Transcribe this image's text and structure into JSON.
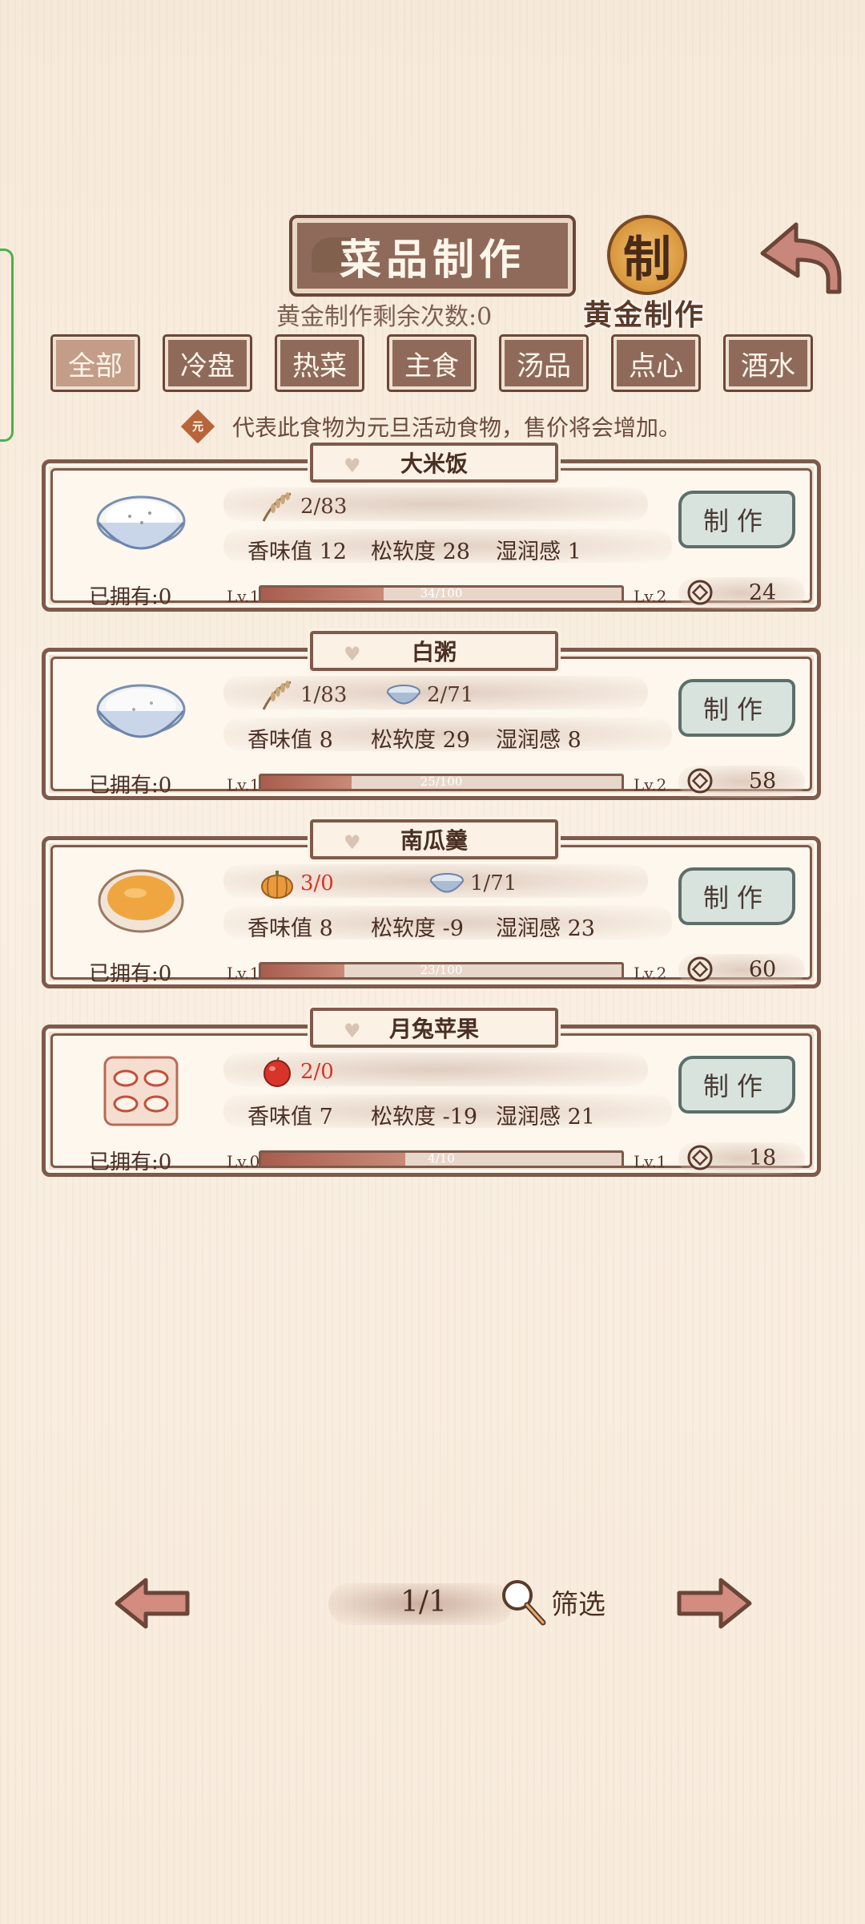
{
  "header": {
    "title": "菜品制作",
    "remaining_gold": "黄金制作剩余次数:0",
    "gold_seal_char": "制",
    "gold_label": "黄金制作"
  },
  "tabs": [
    {
      "label": "全部",
      "active": true
    },
    {
      "label": "冷盘",
      "active": false
    },
    {
      "label": "热菜",
      "active": false
    },
    {
      "label": "主食",
      "active": false
    },
    {
      "label": "汤品",
      "active": false
    },
    {
      "label": "点心",
      "active": false
    },
    {
      "label": "酒水",
      "active": false
    }
  ],
  "notice": {
    "badge": "元",
    "text": "代表此食物为元旦活动食物，售价将会增加。"
  },
  "dishes": [
    {
      "name": "大米饭",
      "owned": "已拥有:0",
      "ingredients": [
        {
          "icon": "rice-stalk-icon",
          "count": "2/83",
          "short": false
        }
      ],
      "stats": {
        "aroma": "香味值 12",
        "softness": "松软度 28",
        "moisture": "湿润感 1"
      },
      "level_current": "Lv.1",
      "level_next": "Lv.2",
      "progress_text": "34/100",
      "progress": 0.34,
      "make_label": "制作",
      "price": "24"
    },
    {
      "name": "白粥",
      "owned": "已拥有:0",
      "ingredients": [
        {
          "icon": "rice-stalk-icon",
          "count": "1/83",
          "short": false
        },
        {
          "icon": "water-bowl-icon",
          "count": "2/71",
          "short": false
        }
      ],
      "stats": {
        "aroma": "香味值 8",
        "softness": "松软度 29",
        "moisture": "湿润感 8"
      },
      "level_current": "Lv.1",
      "level_next": "Lv.2",
      "progress_text": "25/100",
      "progress": 0.25,
      "make_label": "制作",
      "price": "58"
    },
    {
      "name": "南瓜羹",
      "owned": "已拥有:0",
      "ingredients": [
        {
          "icon": "pumpkin-icon",
          "count": "3/0",
          "short": true
        },
        {
          "icon": "water-bowl-icon",
          "count": "1/71",
          "short": false
        }
      ],
      "stats": {
        "aroma": "香味值 8",
        "softness": "松软度 -9",
        "moisture": "湿润感 23"
      },
      "level_current": "Lv.1",
      "level_next": "Lv.2",
      "progress_text": "23/100",
      "progress": 0.23,
      "make_label": "制作",
      "price": "60"
    },
    {
      "name": "月兔苹果",
      "owned": "已拥有:0",
      "ingredients": [
        {
          "icon": "apple-icon",
          "count": "2/0",
          "short": true
        }
      ],
      "stats": {
        "aroma": "香味值 7",
        "softness": "松软度 -19",
        "moisture": "湿润感 21"
      },
      "level_current": "Lv.0",
      "level_next": "Lv.1",
      "progress_text": "4/10",
      "progress": 0.4,
      "make_label": "制作",
      "price": "18"
    }
  ],
  "pager": {
    "page": "1/1",
    "filter_label": "筛选"
  },
  "colors": {
    "frame": "#7e5a4b",
    "short_red": "#d83424",
    "tab_bg": "#8f6a5a",
    "make_btn": "#d8e3de"
  }
}
